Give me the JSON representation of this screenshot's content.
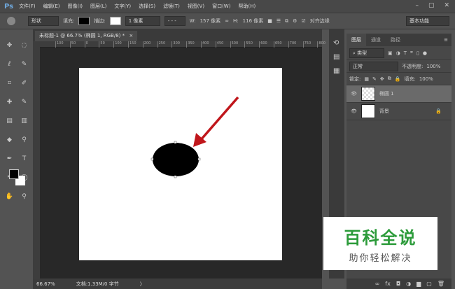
{
  "app": {
    "logo": "Ps",
    "menu": [
      "文件(F)",
      "编辑(E)",
      "图像(I)",
      "图层(L)",
      "文字(Y)",
      "选择(S)",
      "滤镜(T)",
      "视图(V)",
      "窗口(W)",
      "帮助(H)"
    ],
    "window_controls": [
      "–",
      "▢",
      "✕"
    ]
  },
  "options": {
    "mode": "形状",
    "fill_label": "填充:",
    "stroke_label": "描边:",
    "stroke_width": "1 像素",
    "w_label": "W:",
    "w_value": "157 像素",
    "link": "∞",
    "h_label": "H:",
    "h_value": "116 像素",
    "align_edges": "对齐边缘",
    "workspace": "基本功能"
  },
  "document": {
    "tab": "未标题-1 @ 66.7% (椭圆 1, RGB/8) *",
    "close": "×",
    "ruler": [
      "100",
      "50",
      "0",
      "50",
      "100",
      "150",
      "200",
      "250",
      "300",
      "350",
      "400",
      "450",
      "500",
      "550",
      "600",
      "650",
      "700",
      "750",
      "800"
    ],
    "arrow_color": "#c0161b"
  },
  "tools": [
    "✥",
    "◌",
    "ℓ",
    "✎",
    "⌗",
    "✐",
    "✚",
    "✎",
    "▤",
    "▥",
    "◆",
    "⚲",
    "✒",
    "T",
    "↖",
    "◯",
    "✋",
    "⚲"
  ],
  "panel": {
    "tabs": [
      "图层",
      "通道",
      "路径"
    ],
    "filter": "类型",
    "blend": "正常",
    "opacity_label": "不透明度:",
    "opacity": "100%",
    "lock_label": "锁定:",
    "fill_label": "填充:",
    "fill": "100%",
    "layers": [
      {
        "name": "椭圆 1",
        "selected": true
      },
      {
        "name": "背景",
        "locked": true
      }
    ],
    "bottom_icons": [
      "∞",
      "fx",
      "◘",
      "◑",
      "▆",
      "▢",
      "🗑"
    ]
  },
  "status": {
    "zoom": "66.67%",
    "doc": "文档:1.33M/0 字节",
    "arrow": "〉"
  },
  "watermark": {
    "title": "百科全说",
    "subtitle": "助你轻松解决"
  }
}
